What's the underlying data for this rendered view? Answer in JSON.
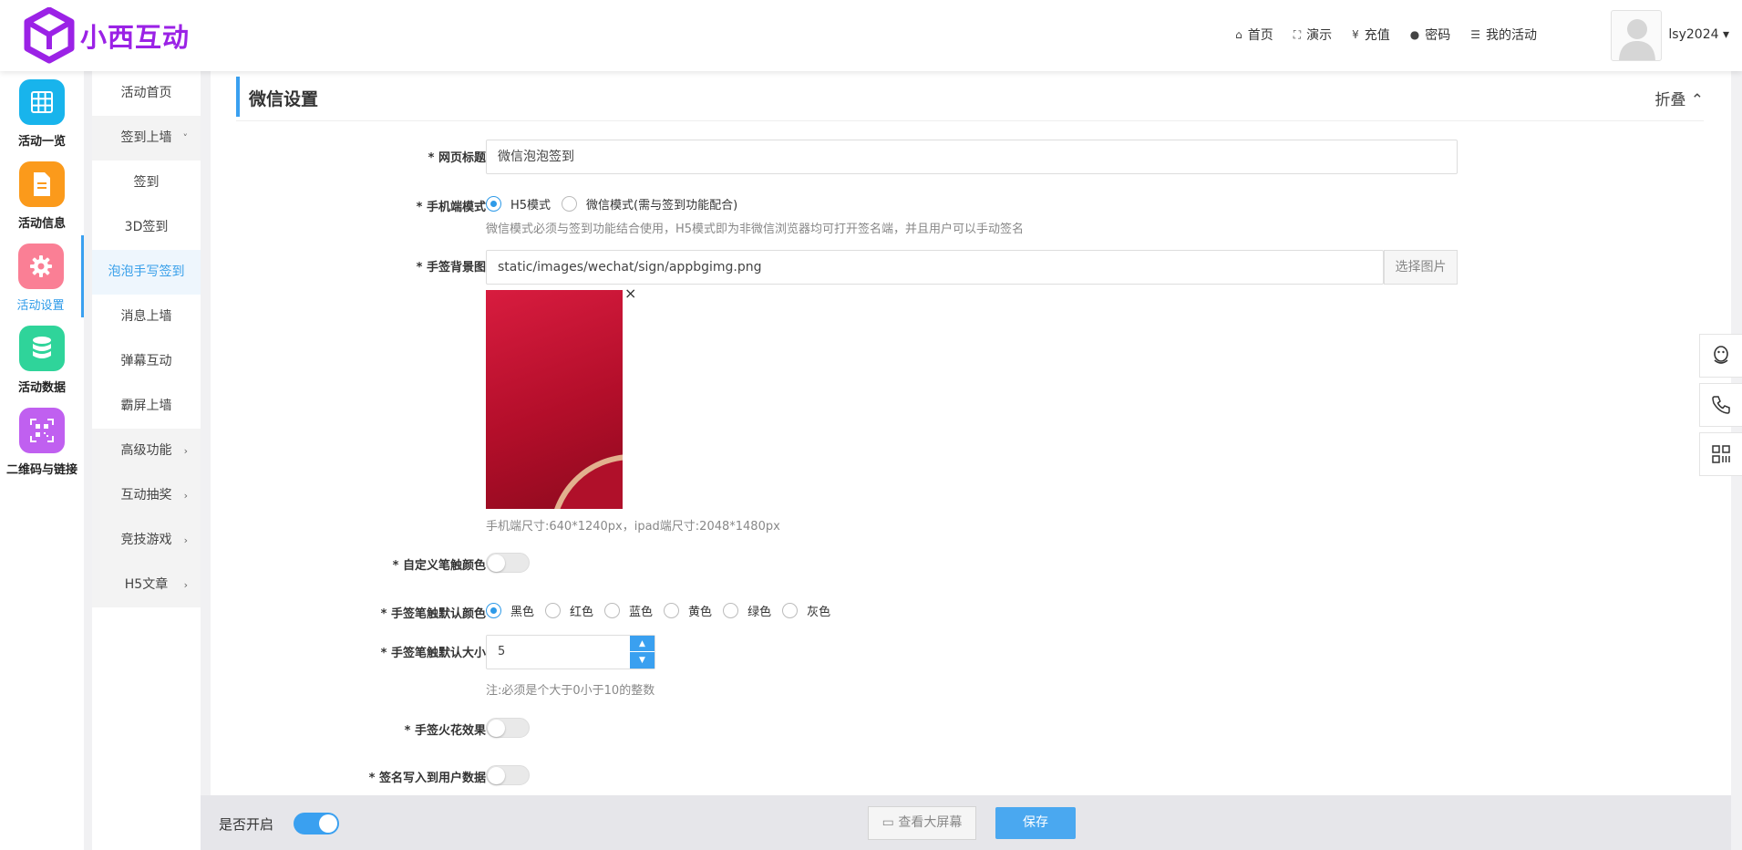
{
  "header": {
    "brand": "小西互动",
    "nav": [
      {
        "label": "首页",
        "icon": "home-icon",
        "glyph": "⌂"
      },
      {
        "label": "演示",
        "icon": "fullscreen-icon",
        "glyph": "⛶"
      },
      {
        "label": "充值",
        "icon": "yen-icon",
        "glyph": "¥"
      },
      {
        "label": "密码",
        "icon": "check-circle-icon",
        "glyph": "●"
      },
      {
        "label": "我的活动",
        "icon": "list-icon",
        "glyph": "☰"
      }
    ],
    "username": "lsy2024 ▾"
  },
  "sidebar": {
    "items": [
      {
        "label": "活动一览",
        "color": "#18b4ec"
      },
      {
        "label": "活动信息",
        "color": "#fb9a1b"
      },
      {
        "label": "活动设置",
        "color": "#fa7f95"
      },
      {
        "label": "活动数据",
        "color": "#2fd49a"
      },
      {
        "label": "二维码与链接",
        "color": "#c060f0"
      }
    ]
  },
  "submenu": {
    "items": [
      {
        "label": "活动首页"
      },
      {
        "label": "签到上墙",
        "chev": "˅"
      },
      {
        "label": "签到"
      },
      {
        "label": "3D签到"
      },
      {
        "label": "泡泡手写签到"
      },
      {
        "label": "消息上墙"
      },
      {
        "label": "弹幕互动"
      },
      {
        "label": "霸屏上墙"
      },
      {
        "label": "高级功能",
        "chev": "›"
      },
      {
        "label": "互动抽奖",
        "chev": "›"
      },
      {
        "label": "竞技游戏",
        "chev": "›"
      },
      {
        "label": "H5文章",
        "chev": "›"
      }
    ]
  },
  "panel": {
    "title": "微信设置",
    "fold_label": "折叠 ⌃"
  },
  "form": {
    "page_title": {
      "label": "* 网页标题",
      "value": "微信泡泡签到"
    },
    "mobile_mode": {
      "label": "* 手机端模式",
      "options": [
        "H5模式",
        "微信模式(需与签到功能配合)"
      ],
      "selected": 0,
      "hint": "微信模式必须与签到功能结合使用，H5模式即为非微信浏览器均可打开签名端，并且用户可以手动签名"
    },
    "bg_image": {
      "label": "* 手签背景图",
      "value": "static/images/wechat/sign/appbgimg.png",
      "button": "选择图片",
      "close": "×",
      "hint": "手机端尺寸:640*1240px，ipad端尺寸:2048*1480px"
    },
    "custom_color": {
      "label": "* 自定义笔触颜色",
      "on": false
    },
    "default_color": {
      "label": "* 手签笔触默认颜色",
      "options": [
        "黑色",
        "红色",
        "蓝色",
        "黄色",
        "绿色",
        "灰色"
      ],
      "selected": 0
    },
    "default_size": {
      "label": "* 手签笔触默认大小",
      "value": "5",
      "hint": "注:必须是个大于0小于10的整数"
    },
    "spark": {
      "label": "* 手签火花效果",
      "on": false
    },
    "write_user": {
      "label": "* 签名写入到用户数据",
      "on": false
    }
  },
  "footer": {
    "enable_label": "是否开启",
    "enabled": true,
    "view_button": "查看大屏幕",
    "save_button": "保存"
  }
}
